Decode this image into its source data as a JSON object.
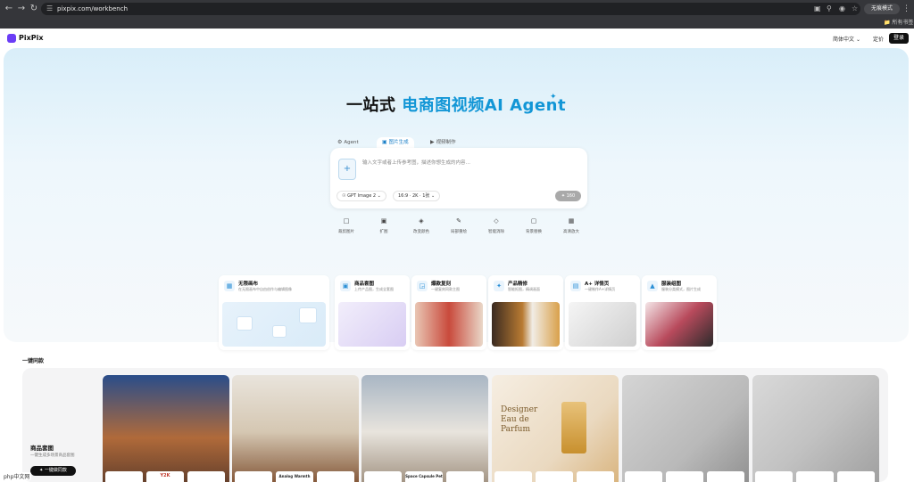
{
  "browser": {
    "url": "pixpix.com/workbench",
    "incognito_label": "无痕模式",
    "bookmarks_label": "所有书签"
  },
  "header": {
    "logo_text": "PixPix",
    "language": "简体中文",
    "pricing": "定价",
    "login": "登录"
  },
  "hero": {
    "title_prefix": "一站式",
    "title_highlight": "电商图视频AI Agent",
    "tabs": [
      {
        "label": "Agent",
        "icon": "agent-icon"
      },
      {
        "label": "图片生成",
        "icon": "image-icon"
      },
      {
        "label": "视频制作",
        "icon": "video-icon"
      }
    ],
    "active_tab": "图片生成",
    "prompt_placeholder": "输入文字或者上传参考图，描述你想生成的内容…",
    "model": "GPT Image 2",
    "settings": "16:9 · 2K · 1张",
    "generate_label": "160"
  },
  "tools": [
    {
      "label": "裁剪图片",
      "icon": "crop-icon"
    },
    {
      "label": "扩图",
      "icon": "expand-icon"
    },
    {
      "label": "改变颜色",
      "icon": "palette-icon"
    },
    {
      "label": "局部重绘",
      "icon": "brush-icon"
    },
    {
      "label": "智能消除",
      "icon": "eraser-icon"
    },
    {
      "label": "背景替换",
      "icon": "background-icon"
    },
    {
      "label": "高清放大",
      "icon": "upscale-icon"
    }
  ],
  "cards": [
    {
      "title": "无限画布",
      "subtitle": "在无限画布中自由创作与编辑图像",
      "icon": "canvas-icon"
    },
    {
      "title": "商品套图",
      "subtitle": "上传产品图，生成全套图",
      "icon": "product-icon"
    },
    {
      "title": "爆款复刻",
      "subtitle": "一键复刻同款主图",
      "icon": "copy-icon"
    },
    {
      "title": "产品精修",
      "subtitle": "智能抠图，精调画面",
      "icon": "retouch-icon"
    },
    {
      "title": "A+ 详情页",
      "subtitle": "一键制作A+详情页",
      "icon": "detail-page-icon"
    },
    {
      "title": "服装组图",
      "subtitle": "服装分类模式，图片生成",
      "icon": "clothing-icon"
    }
  ],
  "section": {
    "title": "一键同款",
    "gallery_title": "商品套图",
    "gallery_subtitle": "一键生成多场景商品套图",
    "gallery_button": "一键做同款"
  },
  "gallery": [
    {
      "name": "fashion",
      "thumbs": [
        "",
        "Y2K",
        ""
      ]
    },
    {
      "name": "turntable",
      "thumbs": [
        "",
        "Analog Warmth",
        ""
      ]
    },
    {
      "name": "pet-backpack",
      "thumbs": [
        "",
        "Space Capsule Pet Carrier",
        ""
      ]
    },
    {
      "name": "perfume",
      "thumbs": [
        "",
        "",
        ""
      ],
      "headline": "Designer Eau de Parfum"
    },
    {
      "name": "hair-dryer",
      "thumbs": [
        "",
        "",
        ""
      ]
    },
    {
      "name": "earbuds",
      "thumbs": [
        "",
        "",
        ""
      ]
    }
  ],
  "watermark": "php中文网"
}
